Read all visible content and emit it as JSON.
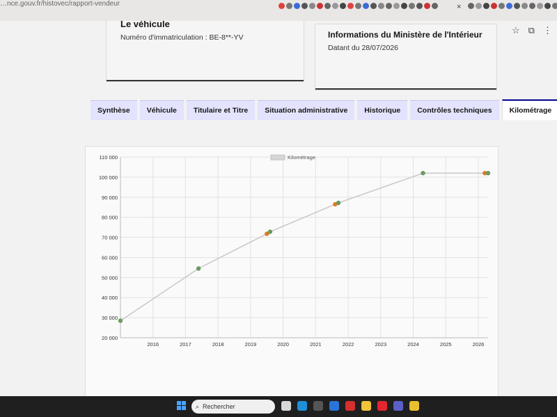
{
  "browser": {
    "url": "…nce.gouv.fr/histovec/rapport-vendeur",
    "close_glyph": "×",
    "toolbar": [
      "☆",
      "⧉",
      "⋮"
    ]
  },
  "vehicle_card": {
    "title": "Le véhicule",
    "plate_label": "Numéro d'immatriculation : BE-8**-YV"
  },
  "ministry_card": {
    "title": "Informations du Ministère de l'Intérieur",
    "date_text": "Datant du 28/07/2026"
  },
  "tabs": [
    {
      "label": "Synthèse",
      "active": false
    },
    {
      "label": "Véhicule",
      "active": false
    },
    {
      "label": "Titulaire et Titre",
      "active": false
    },
    {
      "label": "Situation administrative",
      "active": false
    },
    {
      "label": "Historique",
      "active": false
    },
    {
      "label": "Contrôles techniques",
      "active": false
    },
    {
      "label": "Kilométrage",
      "active": true
    }
  ],
  "chart_data": {
    "type": "line",
    "title": "",
    "legend": {
      "labels": [
        "Kilométrage"
      ],
      "position": "top-center"
    },
    "xlabel": "",
    "ylabel": "",
    "x_ticks": [
      "2016",
      "2017",
      "2018",
      "2019",
      "2020",
      "2021",
      "2022",
      "2023",
      "2024",
      "2025",
      "2026"
    ],
    "y_ticks": [
      "20 000",
      "30 000",
      "40 000",
      "50 000",
      "60 000",
      "70 000",
      "80 000",
      "90 000",
      "100 000",
      "110 000"
    ],
    "ylim": [
      20000,
      110000
    ],
    "xlim": [
      2015.0,
      2026.3
    ],
    "grid": true,
    "series": [
      {
        "name": "Kilométrage",
        "color": "#c8c8c8",
        "points": [
          {
            "x": 2015.0,
            "y": 28500,
            "color": "#6a9a5f"
          },
          {
            "x": 2017.4,
            "y": 54500,
            "color": "#6a9a5f"
          },
          {
            "x": 2019.5,
            "y": 71800,
            "color": "#e07a1f"
          },
          {
            "x": 2019.6,
            "y": 72800,
            "color": "#6a9a5f"
          },
          {
            "x": 2021.6,
            "y": 86500,
            "color": "#e07a1f"
          },
          {
            "x": 2021.7,
            "y": 87200,
            "color": "#6a9a5f"
          },
          {
            "x": 2024.3,
            "y": 102000,
            "color": "#6a9a5f"
          },
          {
            "x": 2026.2,
            "y": 102000,
            "color": "#e07a1f"
          },
          {
            "x": 2026.3,
            "y": 102000,
            "color": "#6a9a5f"
          }
        ]
      }
    ]
  },
  "taskbar": {
    "search_placeholder": "Rechercher",
    "search_glyph": "⌕",
    "apps": [
      {
        "icon": "files-app-icon",
        "color": "#d9d9d9"
      },
      {
        "icon": "edge-icon",
        "color": "#1f8fd6"
      },
      {
        "icon": "store-icon",
        "color": "#555"
      },
      {
        "icon": "mail-icon",
        "color": "#2a73d8"
      },
      {
        "icon": "l-app-icon",
        "color": "#d62f2f"
      },
      {
        "icon": "explorer-icon",
        "color": "#f0c33c"
      },
      {
        "icon": "opera-icon",
        "color": "#e3262f"
      },
      {
        "icon": "teams-icon",
        "color": "#5b5fc7"
      },
      {
        "icon": "chrome-icon",
        "color": "#e8c02f"
      }
    ]
  }
}
